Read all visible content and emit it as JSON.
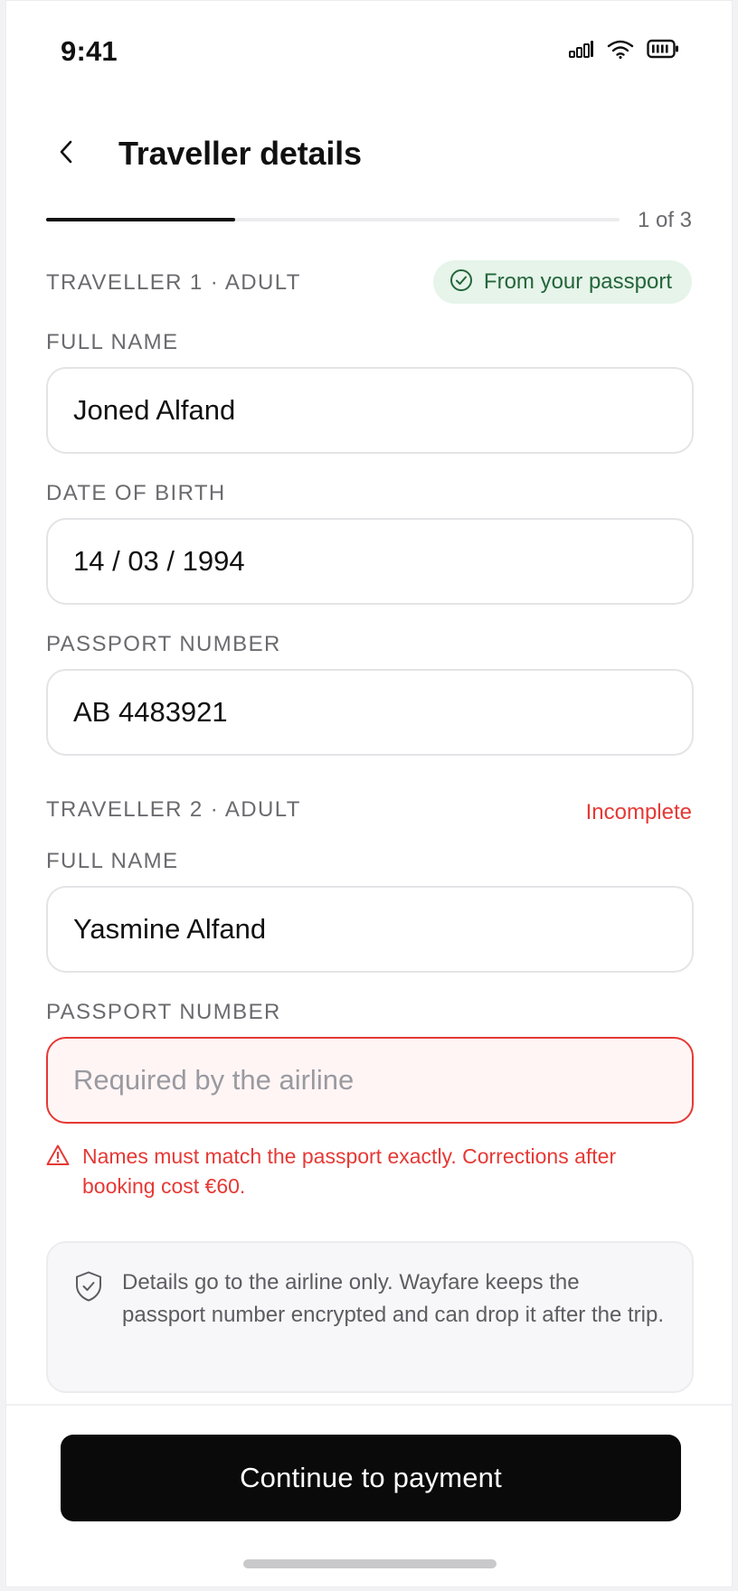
{
  "status_bar": {
    "time": "9:41",
    "icons": [
      "signal-icon",
      "wifi-icon",
      "battery-icon"
    ]
  },
  "header": {
    "title": "Traveller details",
    "back_icon": "chevron-left-icon"
  },
  "progress": {
    "label": "1 of 3",
    "fraction": 0.33
  },
  "traveller1": {
    "section_label": "TRAVELLER 1 · ADULT",
    "badge": {
      "text": "From your passport",
      "icon": "check-circle-icon"
    },
    "full_name": {
      "label": "FULL NAME",
      "value": "Joned Alfand"
    },
    "date_of_birth": {
      "label": "DATE OF BIRTH",
      "value": "14 / 03 / 1994"
    },
    "passport_number": {
      "label": "PASSPORT NUMBER",
      "value": "AB 4483921"
    }
  },
  "traveller2": {
    "section_label": "TRAVELLER 2 · ADULT",
    "status": "Incomplete",
    "full_name": {
      "label": "FULL NAME",
      "value": "Yasmine Alfand"
    },
    "passport_number": {
      "label": "PASSPORT NUMBER",
      "value": "",
      "placeholder": "Required by the airline"
    },
    "error_message": "Names must match the passport exactly. Corrections after booking cost €60.",
    "error_icon": "alert-triangle-icon"
  },
  "info_card": {
    "icon": "shield-check-icon",
    "text": "Details go to the airline only. Wayfare keeps the passport number encrypted and can drop it after the trip."
  },
  "footer": {
    "cta_label": "Continue to payment"
  },
  "colors": {
    "accent": "#0a0a0a",
    "error": "#e53935",
    "success_bg": "#e6f4ea",
    "success_text": "#24653a"
  }
}
